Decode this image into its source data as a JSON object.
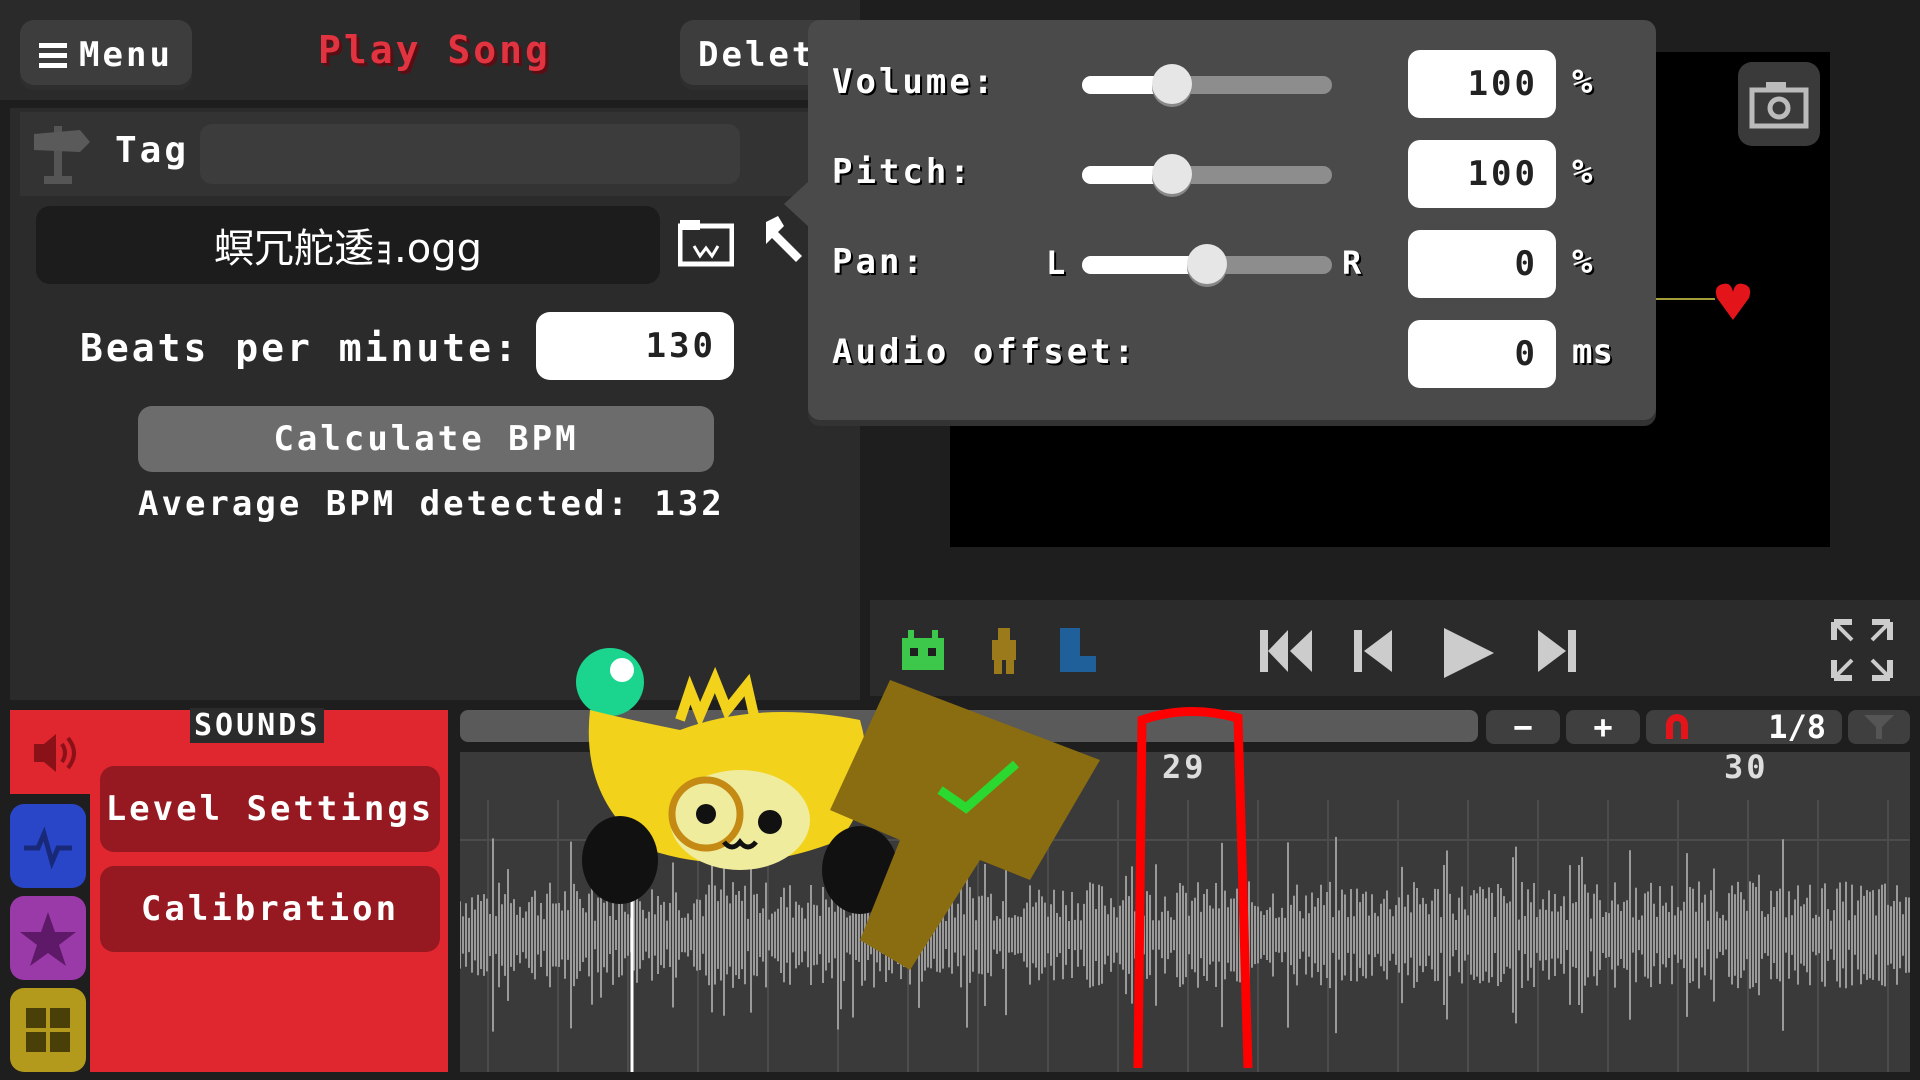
{
  "topbar": {
    "menu_label": "Menu",
    "play_song_label": "Play Song",
    "delete_label": "Delete"
  },
  "song": {
    "tag_label": "Tag",
    "tag_value": "",
    "file_name": "螟冗舵逶ｮ.ogg",
    "bpm_label": "Beats per minute:",
    "bpm_value": "130",
    "calculate_label": "Calculate BPM",
    "average_label": "Average BPM detected: 132"
  },
  "audio_settings": {
    "volume_label": "Volume:",
    "volume_value": "100",
    "volume_unit": "%",
    "volume_level": 0.36,
    "pitch_label": "Pitch:",
    "pitch_value": "100",
    "pitch_unit": "%",
    "pitch_level": 0.36,
    "pan_label": "Pan:",
    "pan_left": "L",
    "pan_right": "R",
    "pan_value": "0",
    "pan_unit": "%",
    "pan_level": 0.5,
    "offset_label": "Audio offset:",
    "offset_value": "0",
    "offset_unit": "ms"
  },
  "sounds_panel": {
    "title": "SOUNDS",
    "level_settings_label": "Level Settings",
    "calibration_label": "Calibration"
  },
  "timeline": {
    "minus_label": "−",
    "plus_label": "+",
    "snap_label": "1/8",
    "bar_numbers": [
      "29",
      "30"
    ]
  },
  "colors": {
    "accent_red": "#e0262f",
    "dark_red": "#961820",
    "tab_blue": "#2a46c8",
    "tab_purple": "#9a3aa8",
    "tab_yellow": "#b39a1c"
  },
  "icons": [
    "hamburger-icon",
    "signpost-icon",
    "folder-icon",
    "wrench-icon",
    "camera-icon",
    "heart-icon",
    "robot-icon",
    "figure-icon",
    "boot-icon",
    "skip-start-icon",
    "step-back-icon",
    "play-icon",
    "step-forward-icon",
    "fullscreen-icon",
    "speaker-icon",
    "pulse-icon",
    "star-icon",
    "grid-icon",
    "magnet-icon",
    "funnel-icon"
  ]
}
